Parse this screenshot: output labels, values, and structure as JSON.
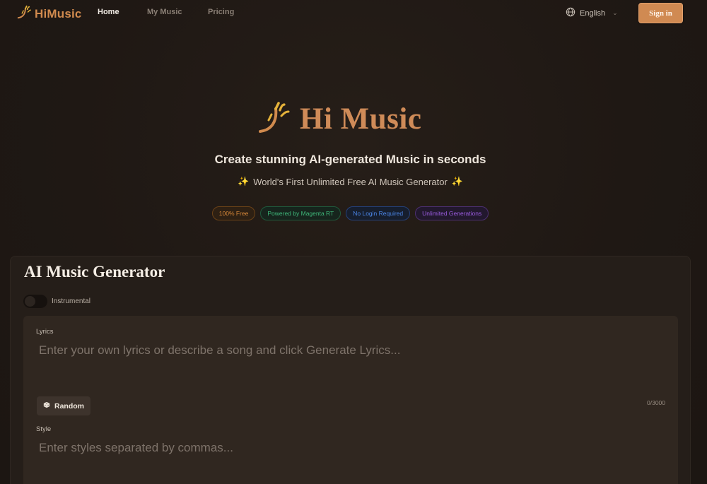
{
  "brand": {
    "name": "HiMusic",
    "icon": "music-wave-icon"
  },
  "nav": {
    "links": [
      {
        "label": "Home",
        "active": true
      },
      {
        "label": "My Music",
        "active": false
      },
      {
        "label": "Pricing",
        "active": false
      }
    ],
    "language": {
      "label": "English",
      "icon": "globe-icon"
    },
    "signin_label": "Sign in"
  },
  "hero": {
    "title": "Hi Music",
    "tagline": "Create stunning AI-generated Music in seconds",
    "subtagline": "World's First Unlimited Free AI Music Generator",
    "badges": [
      {
        "label": "100% Free",
        "color": "#d9893a"
      },
      {
        "label": "Powered by Magenta RT",
        "color": "#3fb87a"
      },
      {
        "label": "No Login Required",
        "color": "#4b86e8"
      },
      {
        "label": "Unlimited Generations",
        "color": "#9b5ce0"
      }
    ]
  },
  "generator": {
    "title": "AI Music Generator",
    "instrumental": {
      "label": "Instrumental",
      "on": false
    },
    "lyrics": {
      "label": "Lyrics",
      "placeholder": "Enter your own lyrics or describe a song and click Generate Lyrics...",
      "value": "",
      "counter": "0/3000"
    },
    "random_label": "Random",
    "style": {
      "label": "Style",
      "placeholder": "Enter styles separated by commas..."
    }
  },
  "colors": {
    "accent": "#d08a52",
    "background": "#1f1915"
  }
}
